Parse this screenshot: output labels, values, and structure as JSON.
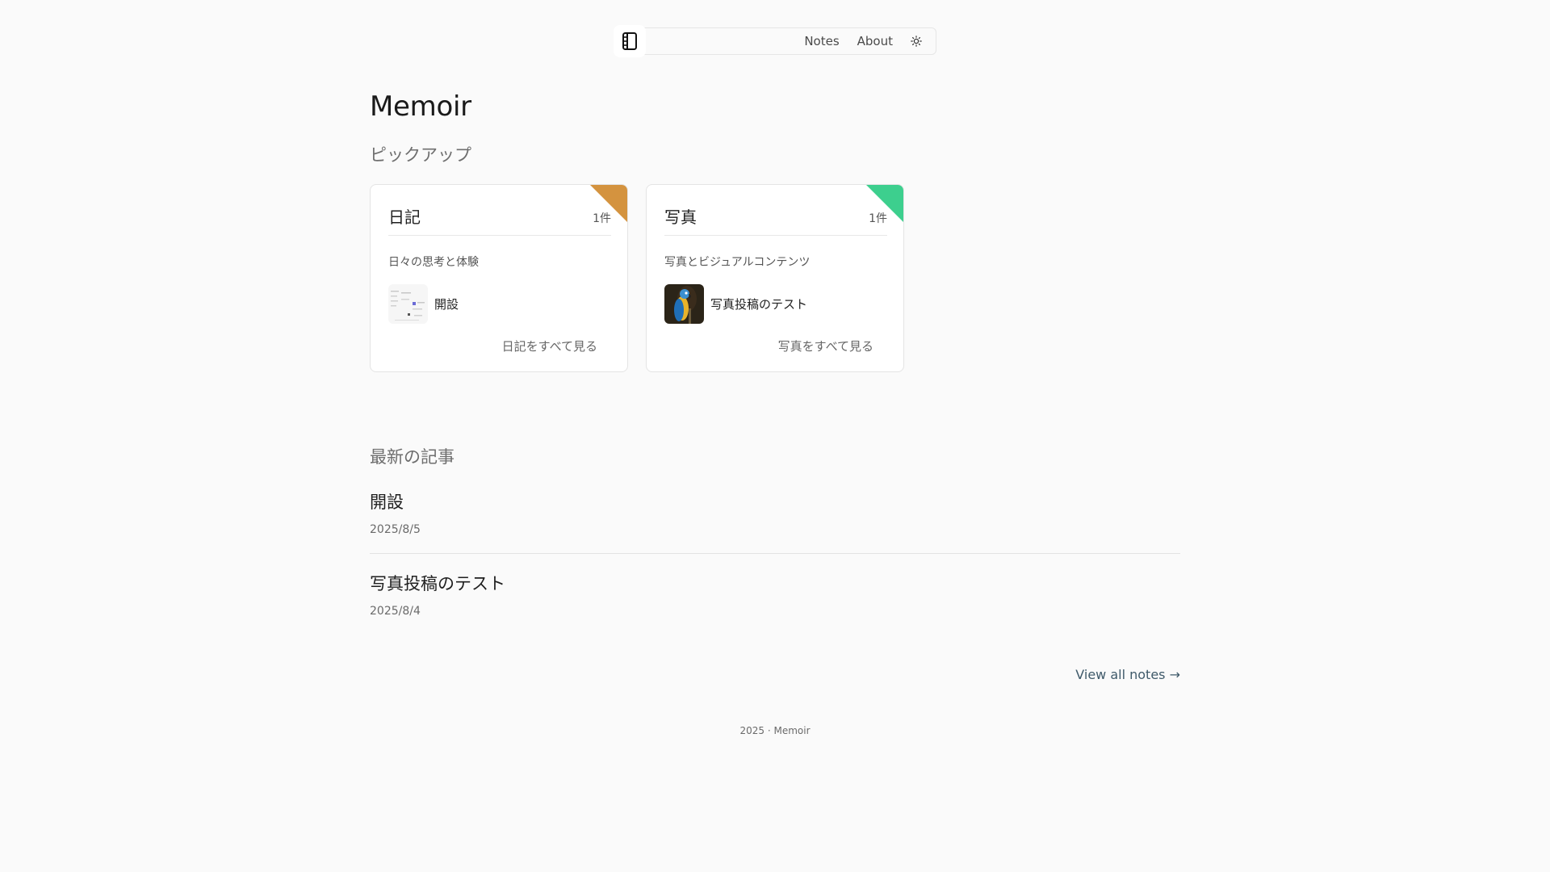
{
  "nav": {
    "links": [
      "Notes",
      "About"
    ],
    "logo_icon": "notebook-icon",
    "theme_icon": "sun-icon"
  },
  "site": {
    "title": "Memoir"
  },
  "pickup": {
    "title": "ピックアップ",
    "cards": [
      {
        "name": "日記",
        "count": "1件",
        "description": "日々の思考と体験",
        "accent": "#d4933f",
        "item_title": "開設",
        "more": "日記をすべて見る"
      },
      {
        "name": "写真",
        "count": "1件",
        "description": "写真とビジュアルコンテンツ",
        "accent": "#3dcf8e",
        "item_title": "写真投稿のテスト",
        "more": "写真をすべて見る"
      }
    ]
  },
  "latest": {
    "title": "最新の記事",
    "posts": [
      {
        "title": "開設",
        "date": "2025/8/5"
      },
      {
        "title": "写真投稿のテスト",
        "date": "2025/8/4"
      }
    ]
  },
  "view_all": "View all notes →",
  "footer": "2025 · Memoir"
}
